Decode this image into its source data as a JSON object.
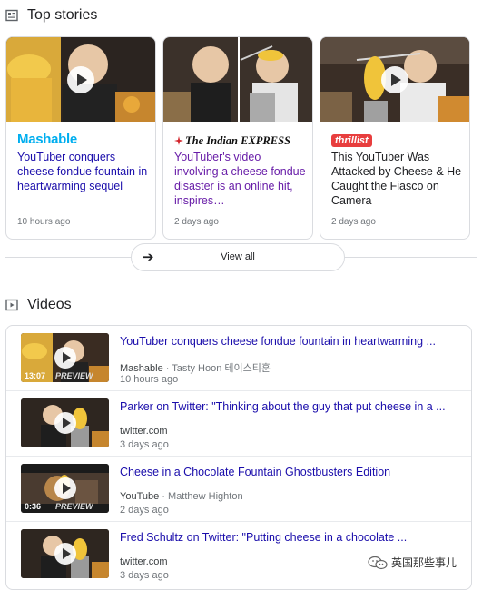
{
  "top_stories": {
    "title": "Top stories",
    "cards": [
      {
        "publisher": "Mashable",
        "headline": "YouTuber conquers cheese fondue fountain in heartwarming sequel",
        "time": "10 hours ago"
      },
      {
        "publisher": "The Indian EXPRESS",
        "headline": "YouTuber's video involving a cheese fondue disaster is an online hit, inspires…",
        "time": "2 days ago"
      },
      {
        "publisher": "thrillist",
        "headline": "This YouTuber Was Attacked by Cheese & He Caught the Fiasco on Camera",
        "time": "2 days ago"
      }
    ],
    "view_all": "View all"
  },
  "videos": {
    "title": "Videos",
    "items": [
      {
        "title": "YouTuber conquers cheese fondue fountain in heartwarming ...",
        "source": "Mashable",
        "author": "Tasty Hoon 테이스티훈",
        "time": "10 hours ago",
        "duration": "13:07",
        "preview": "PREVIEW"
      },
      {
        "title": "Parker on Twitter: \"Thinking about the guy that put cheese in a ...",
        "source": "twitter.com",
        "author": "",
        "time": "3 days ago",
        "duration": "",
        "preview": ""
      },
      {
        "title": "Cheese in a Chocolate Fountain Ghostbusters Edition",
        "source": "YouTube",
        "author": "Matthew Highton",
        "time": "2 days ago",
        "duration": "0:36",
        "preview": "PREVIEW"
      },
      {
        "title": "Fred Schultz on Twitter: \"Putting cheese in a chocolate ...",
        "source": "twitter.com",
        "author": "",
        "time": "3 days ago",
        "duration": "",
        "preview": ""
      }
    ]
  },
  "watermark": "英国那些事儿",
  "colors": {
    "link": "#1a0dab",
    "mashable": "#00aeef",
    "express_red": "#d2232a",
    "thrillist": "#e83e3e"
  }
}
